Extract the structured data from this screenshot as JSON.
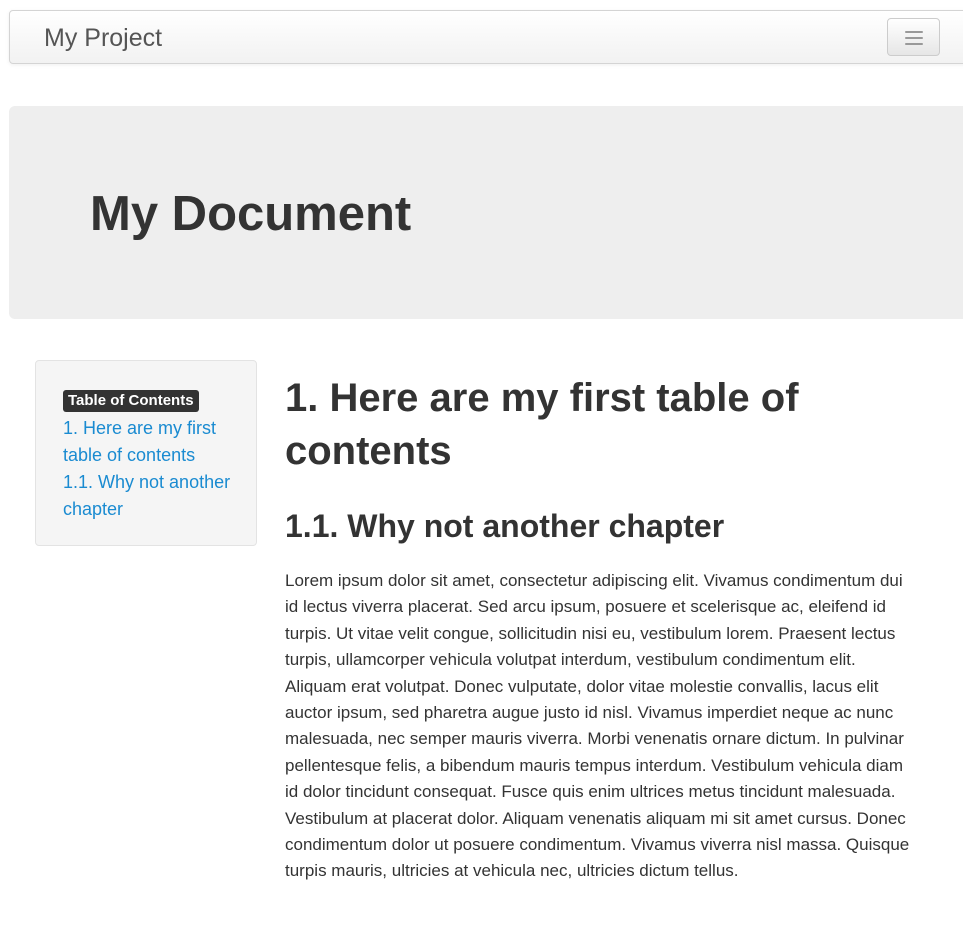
{
  "navbar": {
    "brand": "My Project",
    "toggle_icon": "hamburger-menu-icon"
  },
  "hero": {
    "title": "My Document"
  },
  "toc": {
    "badge": "Table of Contents",
    "items": [
      {
        "label": "1. Here are my first table of contents"
      },
      {
        "label": "1.1. Why not another chapter"
      }
    ]
  },
  "main": {
    "heading_1": "1. Here are my first table of contents",
    "heading_2": "1.1. Why not another chapter",
    "paragraph": "Lorem ipsum dolor sit amet, consectetur adipiscing elit. Vivamus condimentum dui id lectus viverra placerat. Sed arcu ipsum, posuere et scelerisque ac, eleifend id turpis. Ut vitae velit congue, sollicitudin nisi eu, vestibulum lorem. Praesent lectus turpis, ullamcorper vehicula volutpat interdum, vestibulum condimentum elit. Aliquam erat volutpat. Donec vulputate, dolor vitae molestie convallis, lacus elit auctor ipsum, sed pharetra augue justo id nisl. Vivamus imperdiet neque ac nunc malesuada, nec semper mauris viverra. Morbi venenatis ornare dictum. In pulvinar pellentesque felis, a bibendum mauris tempus interdum. Vestibulum vehicula diam id dolor tincidunt consequat. Fusce quis enim ultrices metus tincidunt malesuada. Vestibulum at placerat dolor. Aliquam venenatis aliquam mi sit amet cursus. Donec condimentum dolor ut posuere condimentum. Vivamus viverra nisl massa. Quisque turpis mauris, ultricies at vehicula nec, ultricies dictum tellus."
  },
  "colors": {
    "link": "#1a8bd1",
    "hero_bg": "#eeeeee",
    "badge_bg": "#333333"
  }
}
